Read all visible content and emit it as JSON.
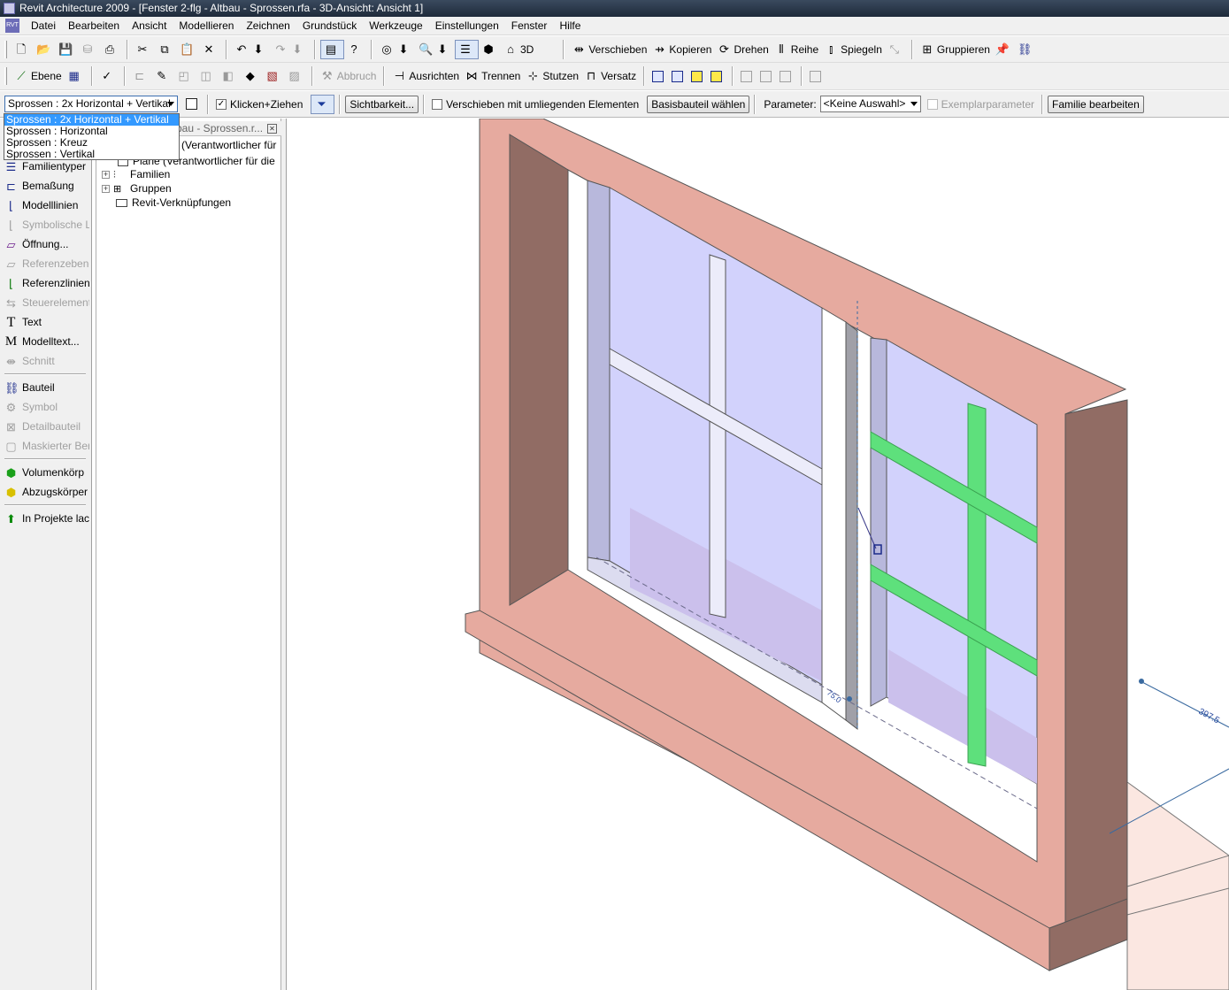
{
  "window": {
    "title": "Revit Architecture 2009 - [Fenster 2-flg - Altbau - Sprossen.rfa - 3D-Ansicht: Ansicht 1]"
  },
  "menu": [
    "Datei",
    "Bearbeiten",
    "Ansicht",
    "Modellieren",
    "Zeichnen",
    "Grundstück",
    "Werkzeuge",
    "Einstellungen",
    "Fenster",
    "Hilfe"
  ],
  "menu_icon_text": "RVT",
  "toolbar1": {
    "three_d": "3D",
    "verschieben": "Verschieben",
    "kopieren": "Kopieren",
    "drehen": "Drehen",
    "reihe": "Reihe",
    "spiegeln": "Spiegeln",
    "gruppieren": "Gruppieren"
  },
  "toolbar2": {
    "ebene": "Ebene",
    "abbruch": "Abbruch",
    "ausrichten": "Ausrichten",
    "trennen": "Trennen",
    "stutzen": "Stutzen",
    "versatz": "Versatz"
  },
  "options": {
    "type_selected": "Sprossen : 2x Horizontal + Vertikal",
    "klicken_ziehen": "Klicken+Ziehen",
    "sichtbarkeit": "Sichtbarkeit...",
    "verschieben_umliegend": "Verschieben mit umliegenden Elementen",
    "basisbauteil": "Basisbauteil wählen",
    "parameter_label": "Parameter:",
    "parameter_value": "<Keine Auswahl>",
    "exemplarparameter": "Exemplarparameter",
    "familie_bearbeiten": "Familie bearbeiten"
  },
  "type_options": [
    "Sprossen : 2x Horizontal + Vertikal",
    "Sprossen : Horizontal",
    "Sprossen : Kreuz",
    "Sprossen : Vertikal"
  ],
  "designbar": {
    "familientypen": "Familientyper",
    "bemassung": "Bemaßung",
    "modelllinien": "Modelllinien",
    "symbolische": "Symbolische L",
    "oeffnung": "Öffnung...",
    "referenzebene": "Referenzebene",
    "referenzlinien": "Referenzlinien",
    "steuerelement": "Steuerelement",
    "text": "Text",
    "modelltext": "Modelltext...",
    "schnitt": "Schnitt",
    "bauteil": "Bauteil",
    "symbol": "Symbol",
    "detailbauteil": "Detailbauteil",
    "maskierter": "Maskierter Ber",
    "volumenkoerper": "Volumenkörp",
    "abzugskoerper": "Abzugskörper",
    "in_projekte": "In Projekte lac"
  },
  "browser": {
    "title": "bau - Sprossen.r...",
    "row1": "(Verantwortlicher für die",
    "row2": "Plane (Verantwortlicher für die Bes",
    "familien": "Familien",
    "gruppen": "Gruppen",
    "verknuepfungen": "Revit-Verknüpfungen"
  },
  "viewport": {
    "dim_small": "75.0",
    "dim_large": "397.5"
  },
  "colors": {
    "frame_front": "#e6aa9f",
    "frame_side": "#916c64",
    "glass": "#d2d2fc",
    "highlight": "#5ee07c",
    "title_bar": "#1e2a3a",
    "selection": "#3399ff"
  }
}
